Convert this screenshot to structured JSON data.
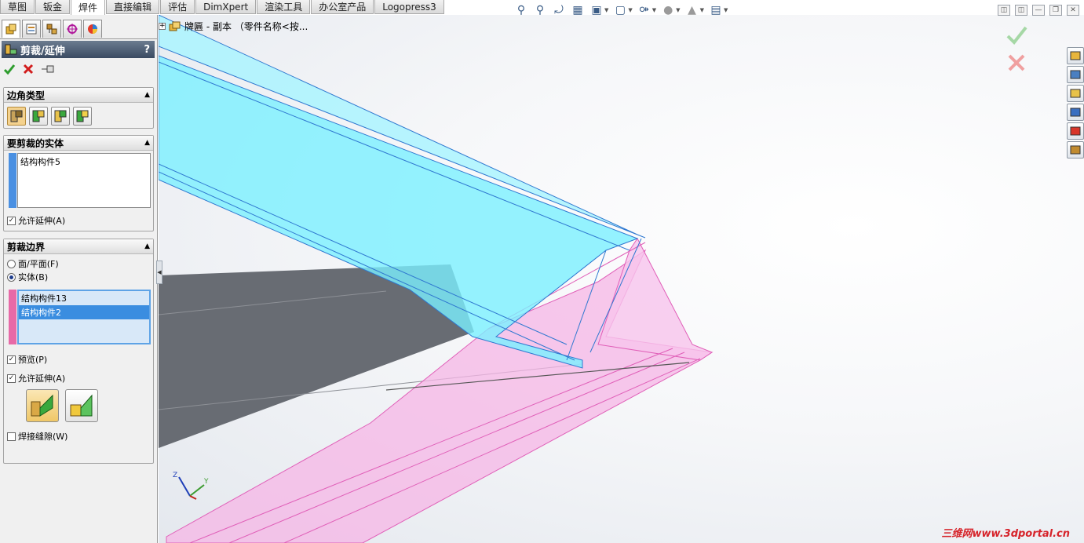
{
  "tabs": [
    "草图",
    "钣金",
    "焊件",
    "直接编辑",
    "评估",
    "DimXpert",
    "渲染工具",
    "办公室产品",
    "Logopress3"
  ],
  "active_tab_index": 2,
  "feature_tree": {
    "part_name": "牌匾 - 副本 （零件名称<按..."
  },
  "property_manager": {
    "title": "剪裁/延伸",
    "help_symbol": "?",
    "corner_type": {
      "label": "边角类型",
      "options": [
        "end-trim-icon",
        "end-miter-icon",
        "end-butt-1-icon",
        "end-butt-2-icon"
      ],
      "active_index": 0
    },
    "bodies_to_trim": {
      "label": "要剪裁的实体",
      "items": [
        "结构构件5"
      ],
      "allow_extension_label": "允许延伸(A)",
      "allow_extension_checked": true,
      "color": "#4a90e2"
    },
    "trim_boundary": {
      "label": "剪裁边界",
      "face_plane_label": "面/平面(F)",
      "body_label": "实体(B)",
      "selected": "body",
      "items": [
        "结构构件13",
        "结构构件2"
      ],
      "selected_item_index": 1,
      "preview_label": "预览(P)",
      "preview_checked": true,
      "allow_extension_label": "允许延伸(A)",
      "allow_extension_checked": true,
      "weld_gap_label": "焊接缝隙(W)",
      "weld_gap_checked": false,
      "color": "#e76aa7"
    }
  },
  "hud_icons": [
    "zoom-to-fit-icon",
    "zoom-area-icon",
    "previous-view-icon",
    "section-view-icon",
    "view-orientation-icon",
    "display-style-icon",
    "hide-show-icon",
    "appearance-icon",
    "scene-icon",
    "view-settings-icon"
  ],
  "task_pane_icons": [
    "home-icon",
    "design-library-icon",
    "file-explorer-icon",
    "view-palette-icon",
    "appearances-icon",
    "custom-properties-icon"
  ],
  "triad_axes": [
    "Z",
    "Y"
  ],
  "watermark": "三维网www.3dportal.cn",
  "colors": {
    "trim_body": "#7af0ff",
    "boundary_body": "#f6a6de",
    "grey_body": "#686c73",
    "panel_bg": "#f0f0f0"
  }
}
